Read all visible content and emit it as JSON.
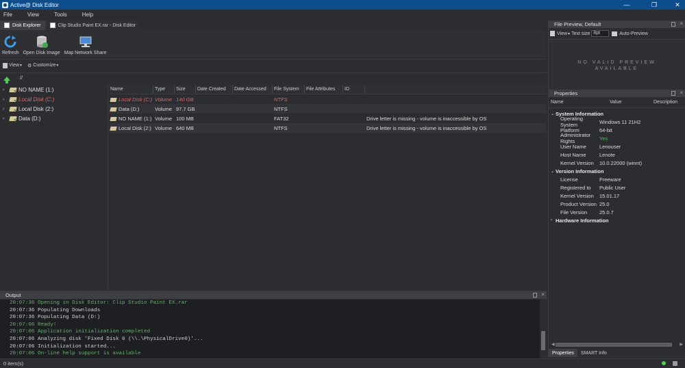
{
  "window": {
    "title": "Active@ Disk Editor",
    "controls": [
      "—",
      "❐",
      "✕"
    ]
  },
  "menu": [
    "File",
    "View",
    "Tools",
    "Help"
  ],
  "tabs": [
    {
      "label": "Disk Explorer"
    },
    {
      "label": "Clip Studio Paint EX.rar - Disk Editor"
    }
  ],
  "toolbar": [
    {
      "label": "Refresh",
      "icon": "refresh-icon"
    },
    {
      "label": "Open Disk Image",
      "icon": "disk-image-icon"
    },
    {
      "label": "Map Network Share",
      "icon": "network-share-icon"
    }
  ],
  "subbar": {
    "view": "View",
    "customize": "Customize"
  },
  "path": "//",
  "tree": [
    "NO NAME (1:)",
    "Local Disk (C:)",
    "Local Disk (2:)",
    "Data (D:)"
  ],
  "list": {
    "columns": [
      "Name",
      "Type",
      "Size",
      "Date Created",
      "Date Accessed",
      "File System",
      "File Attributes",
      "ID"
    ],
    "rows": [
      {
        "name": "Local Disk (C:)",
        "type": "Volume",
        "size": "140 GB",
        "fs": "NTFS",
        "note": ""
      },
      {
        "name": "Data (D:)",
        "type": "Volume",
        "size": "97.7 GB",
        "fs": "NTFS",
        "note": ""
      },
      {
        "name": "NO NAME (1:)",
        "type": "Volume",
        "size": "100 MB",
        "fs": "FAT32",
        "note": "Drive letter is missing - volume is inaccessible by OS"
      },
      {
        "name": "Local Disk (2:)",
        "type": "Volume",
        "size": "640 MB",
        "fs": "NTFS",
        "note": "Drive letter is missing - volume is inaccessible by OS"
      }
    ]
  },
  "preview": {
    "title": "File Preview, Default",
    "view": "View",
    "text_size_label": "Text size",
    "text_size": "8pt",
    "auto": "Auto-Preview",
    "line1": "NO VALID PREVIEW",
    "line2": "AVAILABLE"
  },
  "properties": {
    "title": "Properties",
    "columns": [
      "Name",
      "Value",
      "Description"
    ],
    "groups": [
      {
        "name": "System Information",
        "items": [
          {
            "k": "Operating System",
            "v": "Windows 11 21H2"
          },
          {
            "k": "Platform",
            "v": "64-bit"
          },
          {
            "k": "Administrator Rights",
            "v": "Yes"
          },
          {
            "k": "User Name",
            "v": "Lenouser"
          },
          {
            "k": "Host Name",
            "v": "Lenote"
          },
          {
            "k": "Kernel Version",
            "v": "10.0.22000 (winnt)"
          }
        ]
      },
      {
        "name": "Version Information",
        "items": [
          {
            "k": "License",
            "v": "Freeware"
          },
          {
            "k": "Registered to",
            "v": "Public User"
          },
          {
            "k": "Kernel Version",
            "v": "15.01.17"
          },
          {
            "k": "Product Version",
            "v": "25.0"
          },
          {
            "k": "File Version",
            "v": "25.0.7"
          }
        ]
      },
      {
        "name": "Hardware Information",
        "items": []
      }
    ],
    "tabs": [
      "Properties",
      "SMART Info"
    ]
  },
  "output": {
    "title": "Output",
    "lines": [
      {
        "t": "20:07:36 Opening in Disk Editor: Clip Studio Paint EX.rar",
        "g": true
      },
      {
        "t": "20:07:36 Populating Downloads",
        "g": false
      },
      {
        "t": "20:07:36 Populating Data (D:)",
        "g": false
      },
      {
        "t": "20:07:06 Ready!",
        "g": true
      },
      {
        "t": "20:07:06 Application initialization completed",
        "g": true
      },
      {
        "t": "20:07:06 Analyzing disk 'Fixed Disk 0 (\\\\.\\PhysicalDrive0)'...",
        "g": false
      },
      {
        "t": "20:07:06 Initialization started...",
        "g": false
      },
      {
        "t": "20:07:06 On-line help support is available",
        "g": true
      }
    ]
  },
  "status": "0 item(s)",
  "colors": {
    "accent": "#0d4d8b",
    "ok": "#5fb75f",
    "warn": "#e06464"
  }
}
